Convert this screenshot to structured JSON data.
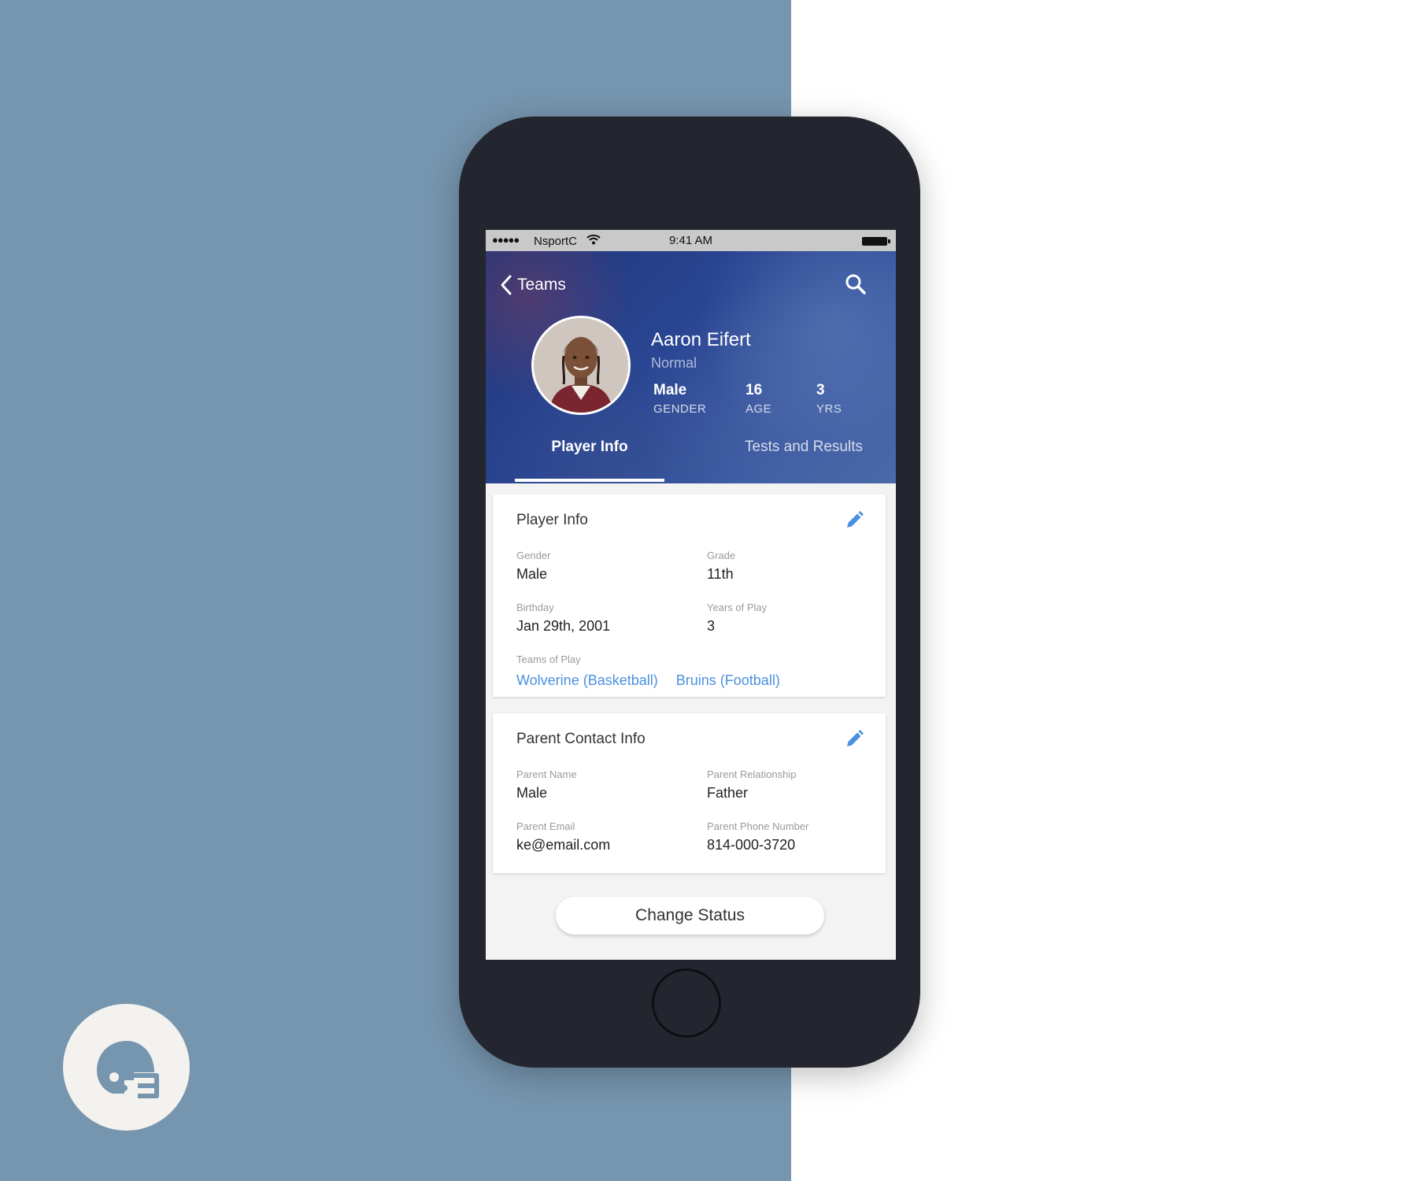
{
  "status_bar": {
    "signal": "●●●●●",
    "carrier": "NsportC",
    "time": "9:41 AM"
  },
  "nav": {
    "back_label": "Teams",
    "back_icon": "chevron-left-icon",
    "search_icon": "search-icon"
  },
  "player": {
    "name": "Aaron Eifert",
    "status": "Normal",
    "stats": [
      {
        "value": "Male",
        "label": "GENDER"
      },
      {
        "value": "16",
        "label": "AGE"
      },
      {
        "value": "3",
        "label": "YRS"
      }
    ]
  },
  "tabs": [
    {
      "label": "Player Info",
      "active": true
    },
    {
      "label": "Tests and Results",
      "active": false
    }
  ],
  "player_info_card": {
    "title": "Player Info",
    "fields": [
      {
        "label": "Gender",
        "value": "Male"
      },
      {
        "label": "Grade",
        "value": "11th"
      },
      {
        "label": "Birthday",
        "value": "Jan 29th, 2001"
      },
      {
        "label": "Years of Play",
        "value": "3"
      }
    ],
    "teams_label": "Teams of Play",
    "teams": [
      "Wolverine (Basketball)",
      "Bruins (Football)"
    ]
  },
  "parent_card": {
    "title": "Parent Contact Info",
    "fields": [
      {
        "label": "Parent Name",
        "value": "Male"
      },
      {
        "label": "Parent Relationship",
        "value": "Father"
      },
      {
        "label": "Parent Email",
        "value": "ke@email.com"
      },
      {
        "label": "Parent Phone Number",
        "value": "814-000-3720"
      }
    ]
  },
  "change_status_label": "Change Status",
  "colors": {
    "background_left": "#7695ae",
    "phone_body": "#23262e",
    "hero_blue": "#2a4694",
    "link_blue": "#4a90e2",
    "edit_icon_blue": "#4a90e2",
    "logo_badge": "#f4f2ef"
  },
  "logo_icon": "football-helmet-icon"
}
